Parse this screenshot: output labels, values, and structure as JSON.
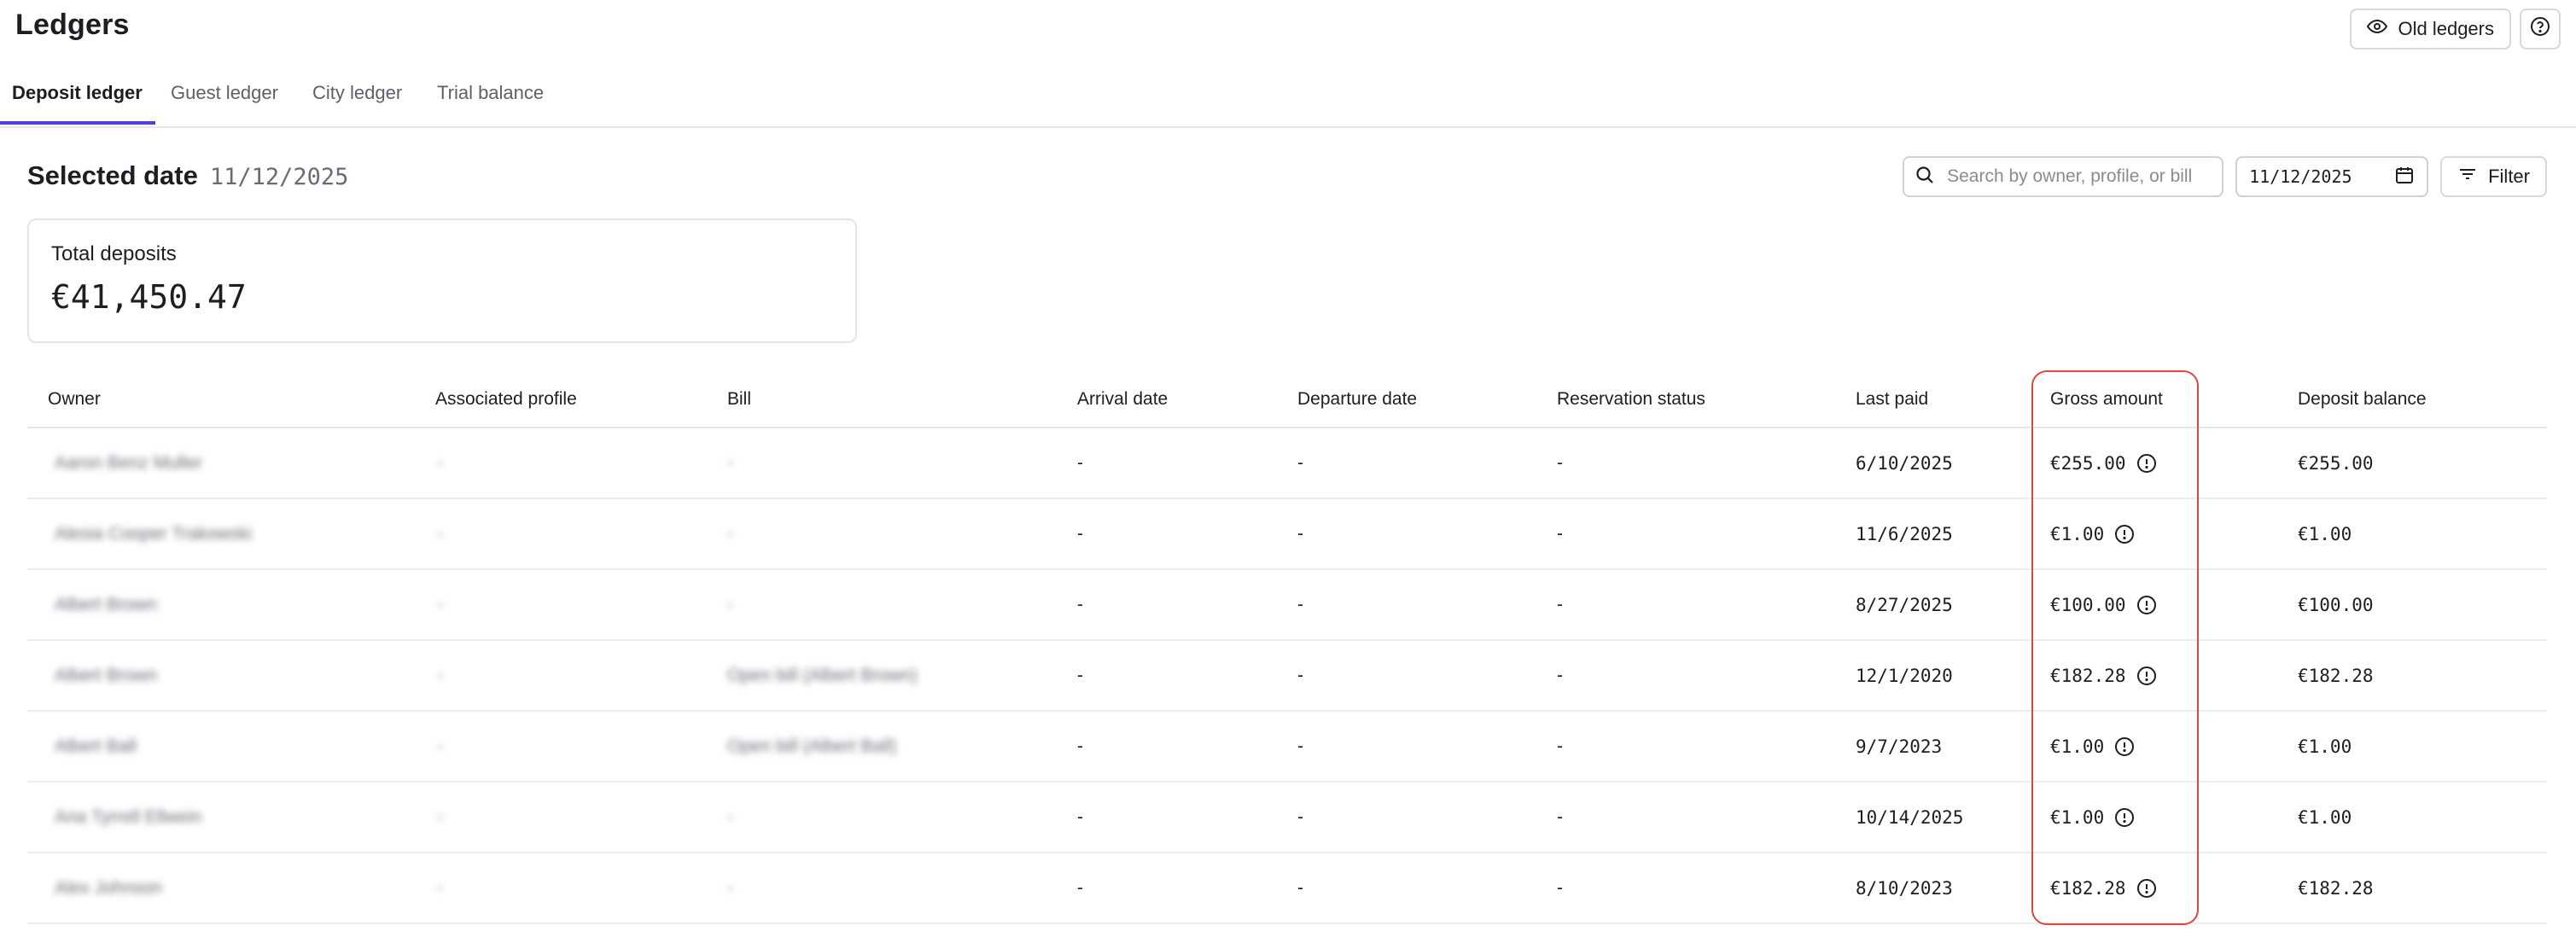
{
  "header": {
    "title": "Ledgers",
    "old_ledgers_label": "Old ledgers",
    "help_icon": "help-circle-icon"
  },
  "tabs": [
    {
      "label": "Deposit ledger",
      "active": true
    },
    {
      "label": "Guest ledger",
      "active": false
    },
    {
      "label": "City ledger",
      "active": false
    },
    {
      "label": "Trial balance",
      "active": false
    }
  ],
  "section": {
    "title": "Selected date",
    "date": "11/12/2025"
  },
  "controls": {
    "search_placeholder": "Search by owner, profile, or bill",
    "date_value": "11/12/2025",
    "filter_label": "Filter"
  },
  "summary": {
    "label": "Total deposits",
    "value": "€41,450.47"
  },
  "table": {
    "columns": [
      "Owner",
      "Associated profile",
      "Bill",
      "Arrival date",
      "Departure date",
      "Reservation status",
      "Last paid",
      "Gross amount",
      "Deposit balance"
    ],
    "rows": [
      {
        "owner": "Aaron Benz Muller",
        "profile": "-",
        "bill": "-",
        "arrival": "-",
        "departure": "-",
        "status": "-",
        "last_paid": "6/10/2025",
        "gross": "€255.00",
        "balance": "€255.00"
      },
      {
        "owner": "Alesia Cooper Trakowski",
        "profile": "-",
        "bill": "-",
        "arrival": "-",
        "departure": "-",
        "status": "-",
        "last_paid": "11/6/2025",
        "gross": "€1.00",
        "balance": "€1.00"
      },
      {
        "owner": "Albert Brown",
        "profile": "-",
        "bill": "-",
        "arrival": "-",
        "departure": "-",
        "status": "-",
        "last_paid": "8/27/2025",
        "gross": "€100.00",
        "balance": "€100.00"
      },
      {
        "owner": "Albert Brown",
        "profile": "-",
        "bill": "Open bill (Albert Brown)",
        "arrival": "-",
        "departure": "-",
        "status": "-",
        "last_paid": "12/1/2020",
        "gross": "€182.28",
        "balance": "€182.28"
      },
      {
        "owner": "Albert Ball",
        "profile": "-",
        "bill": "Open bill (Albert Ball)",
        "arrival": "-",
        "departure": "-",
        "status": "-",
        "last_paid": "9/7/2023",
        "gross": "€1.00",
        "balance": "€1.00"
      },
      {
        "owner": "Ana Tyrrell Ellwein",
        "profile": "-",
        "bill": "-",
        "arrival": "-",
        "departure": "-",
        "status": "-",
        "last_paid": "10/14/2025",
        "gross": "€1.00",
        "balance": "€1.00"
      },
      {
        "owner": "Alex Johnson",
        "profile": "-",
        "bill": "-",
        "arrival": "-",
        "departure": "-",
        "status": "-",
        "last_paid": "8/10/2023",
        "gross": "€182.28",
        "balance": "€182.28"
      }
    ]
  },
  "accent_color": "#4b3fe0",
  "highlight_color": "#e0463a"
}
